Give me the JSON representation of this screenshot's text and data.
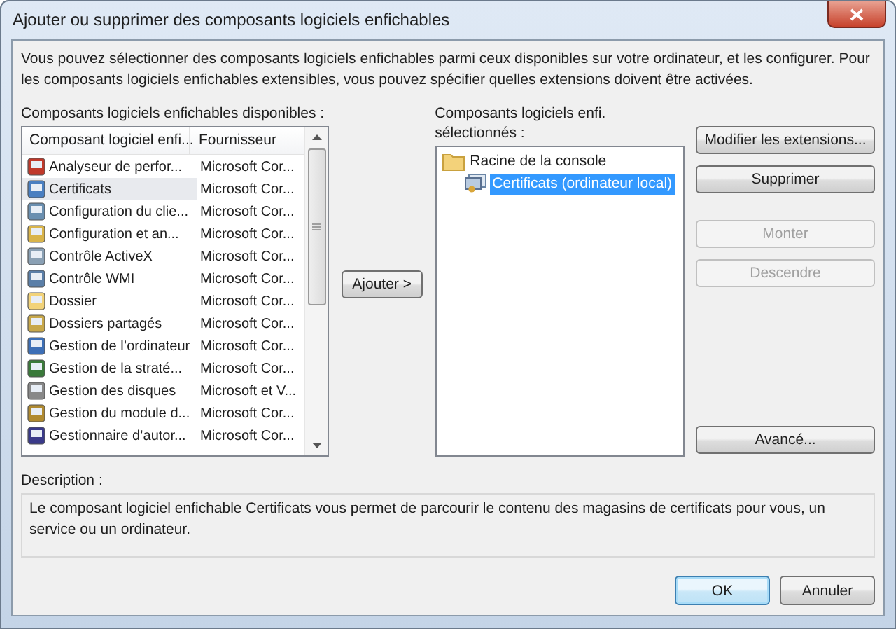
{
  "window": {
    "title": "Ajouter ou supprimer des composants logiciels enfichables"
  },
  "intro": "Vous pouvez sélectionner des composants logiciels enfichables parmi ceux disponibles sur votre ordinateur, et les configurer. Pour les composants logiciels enfichables extensibles, vous pouvez spécifier quelles extensions doivent être activées.",
  "available": {
    "label": "Composants logiciels enfichables disponibles :",
    "columns": [
      "Composant logiciel enfi...",
      "Fournisseur"
    ],
    "rows": [
      {
        "name": "Analyseur de perfor...",
        "vendor": "Microsoft Cor...",
        "selected": false
      },
      {
        "name": "Certificats",
        "vendor": "Microsoft Cor...",
        "selected": true
      },
      {
        "name": "Configuration du clie...",
        "vendor": "Microsoft Cor...",
        "selected": false
      },
      {
        "name": "Configuration et an...",
        "vendor": "Microsoft Cor...",
        "selected": false
      },
      {
        "name": "Contrôle ActiveX",
        "vendor": "Microsoft Cor...",
        "selected": false
      },
      {
        "name": "Contrôle WMI",
        "vendor": "Microsoft Cor...",
        "selected": false
      },
      {
        "name": "Dossier",
        "vendor": "Microsoft Cor...",
        "selected": false
      },
      {
        "name": "Dossiers partagés",
        "vendor": "Microsoft Cor...",
        "selected": false
      },
      {
        "name": "Gestion de l’ordinateur",
        "vendor": "Microsoft Cor...",
        "selected": false
      },
      {
        "name": "Gestion de la straté...",
        "vendor": "Microsoft Cor...",
        "selected": false
      },
      {
        "name": "Gestion des disques",
        "vendor": "Microsoft et V...",
        "selected": false
      },
      {
        "name": "Gestion du module d...",
        "vendor": "Microsoft Cor...",
        "selected": false
      },
      {
        "name": "Gestionnaire d’autor...",
        "vendor": "Microsoft Cor...",
        "selected": false
      }
    ]
  },
  "add_button": "Ajouter >",
  "selected_tree": {
    "label": "Composants logiciels enfi. sélectionnés :",
    "items": [
      {
        "label": "Racine de la console",
        "selected": false,
        "children": [
          {
            "label": "Certificats (ordinateur local)",
            "selected": true
          }
        ]
      }
    ]
  },
  "side_buttons": [
    {
      "label": "Modifier les extensions...",
      "disabled": false
    },
    {
      "label": "Supprimer",
      "disabled": false
    },
    {
      "label": "Monter",
      "disabled": true
    },
    {
      "label": "Descendre",
      "disabled": true
    }
  ],
  "advanced_button": "Avancé...",
  "description": {
    "label": "Description :",
    "text": "Le composant logiciel enfichable Certificats vous permet de parcourir le contenu des magasins de certificats pour vous, un service ou un ordinateur."
  },
  "buttons": [
    {
      "label": "OK",
      "default": true
    },
    {
      "label": "Annuler",
      "default": false
    }
  ]
}
